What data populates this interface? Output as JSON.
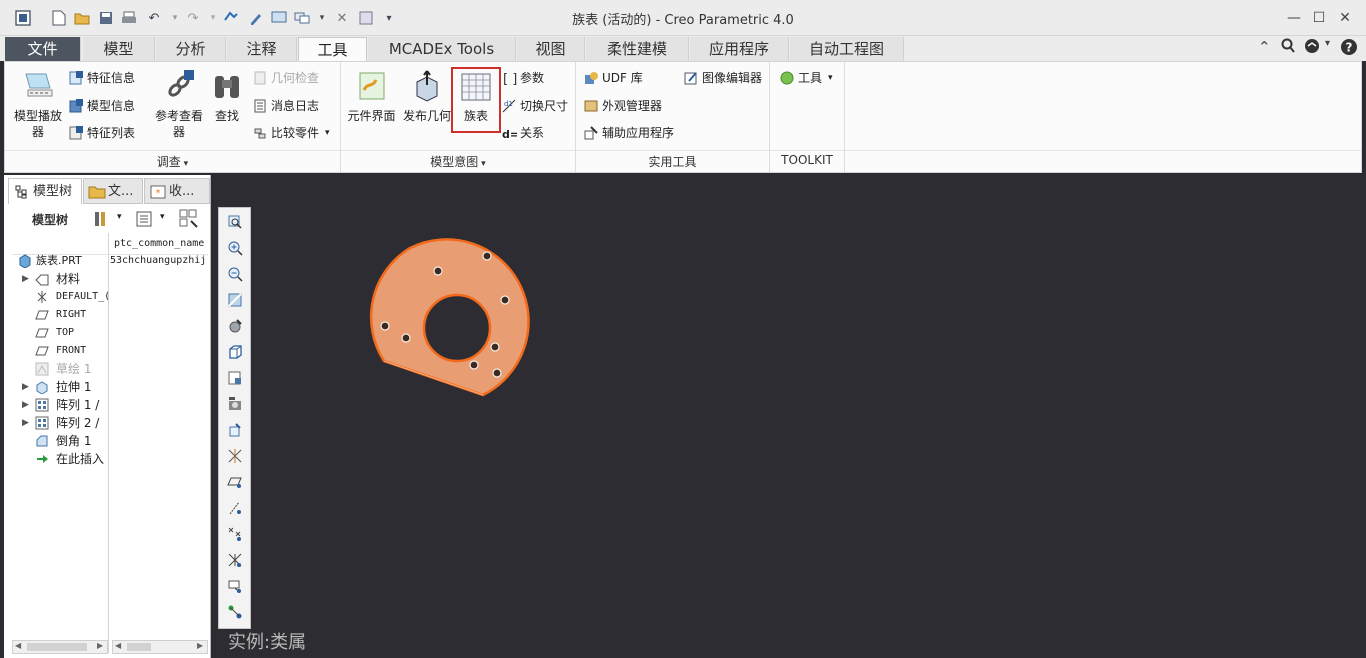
{
  "window": {
    "title": "族表 (活动的) - Creo Parametric 4.0"
  },
  "tabs": [
    "文件",
    "模型",
    "分析",
    "注释",
    "工具",
    "MCADEx Tools",
    "视图",
    "柔性建模",
    "应用程序",
    "自动工程图"
  ],
  "active_tab": "工具",
  "ribbon": {
    "investigate": {
      "label": "调查",
      "model_player": "模型播放\n器",
      "feature_info": "特征信息",
      "model_info": "模型信息",
      "feature_list": "特征列表",
      "ref_viewer": "参考查看\n器",
      "find": "查找",
      "geom_check": "几何检查",
      "message_log": "消息日志",
      "compare_parts": "比较零件"
    },
    "model_intent": {
      "label": "模型意图",
      "component_interface": "元件界面",
      "publish_geom": "发布几何",
      "family_table": "族表",
      "parameters": "参数",
      "switch_dims": "切换尺寸",
      "relations": "关系"
    },
    "utilities": {
      "label": "实用工具",
      "udf_lib": "UDF 库",
      "appearance_mgr": "外观管理器",
      "aux_apps": "辅助应用程序",
      "image_editor": "图像编辑器"
    },
    "toolkit": {
      "label": "TOOLKIT",
      "tools": "工具"
    }
  },
  "left_panel": {
    "tabs": [
      "模型树",
      "文...",
      "收..."
    ],
    "toolbar_title": "模型树",
    "column_header": "ptc_common_name",
    "items": [
      {
        "label": "族表.PRT",
        "value": "53chchuangupzhij",
        "mono": false
      },
      {
        "label": "材料",
        "mono": false
      },
      {
        "label": "DEFAULT_(",
        "mono": true
      },
      {
        "label": "RIGHT",
        "mono": true
      },
      {
        "label": "TOP",
        "mono": true
      },
      {
        "label": "FRONT",
        "mono": true
      },
      {
        "label": "草绘 1",
        "mono": false
      },
      {
        "label": "拉伸 1",
        "mono": false
      },
      {
        "label": "阵列 1 /",
        "mono": false
      },
      {
        "label": "阵列 2 /",
        "mono": false
      },
      {
        "label": "倒角 1",
        "mono": false
      },
      {
        "label": "在此插入",
        "mono": false
      }
    ]
  },
  "graphics": {
    "status_text": "实例:类属"
  },
  "colors": {
    "accent_red": "#d0302a",
    "part_fill": "#e99d73",
    "part_edge": "#f26a1b",
    "background": "#2d2c32"
  }
}
